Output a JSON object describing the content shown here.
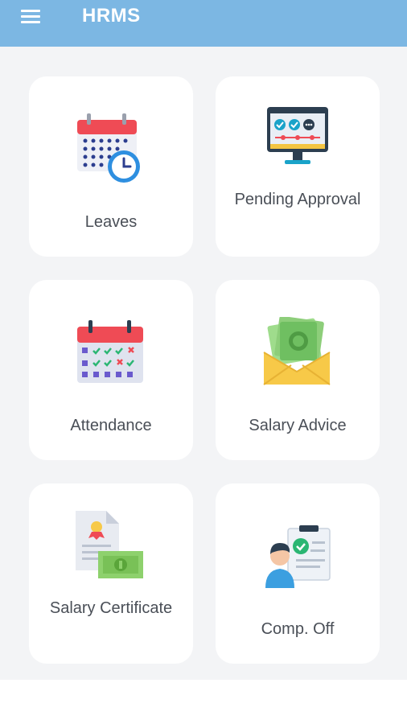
{
  "app": {
    "title": "HRMS"
  },
  "tiles": [
    {
      "label": "Leaves",
      "icon": "calendar-clock-icon"
    },
    {
      "label": "Pending Approval",
      "icon": "monitor-checklist-icon"
    },
    {
      "label": "Attendance",
      "icon": "attendance-calendar-icon"
    },
    {
      "label": "Salary Advice",
      "icon": "money-envelope-icon"
    },
    {
      "label": "Salary Certificate",
      "icon": "certificate-cash-icon"
    },
    {
      "label": "Comp. Off",
      "icon": "employee-approval-icon"
    }
  ],
  "colors": {
    "appbar": "#7cb7e3",
    "background": "#f3f4f6",
    "card": "#ffffff",
    "label": "#4a4f57"
  }
}
